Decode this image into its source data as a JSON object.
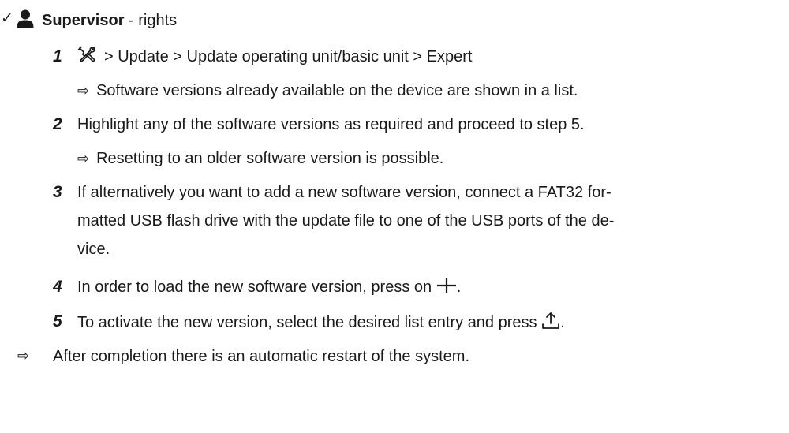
{
  "requirement": {
    "check": "✓",
    "role": "Supervisor",
    "suffix": " - rights"
  },
  "result_arrow": "⇨",
  "steps": [
    {
      "number": "1",
      "path": "> Update > Update operating unit/basic unit > Expert",
      "result": "Software versions already available on the device are shown in a list."
    },
    {
      "number": "2",
      "text": "Highlight any of the software versions as required and proceed to step 5.",
      "result": "Resetting to an older software version is possible."
    },
    {
      "number": "3",
      "lines": [
        "If alternatively you want to add a new software version, connect a FAT32 for-",
        "matted USB flash drive with the update file to one of the USB ports of the de-",
        "vice."
      ]
    },
    {
      "number": "4",
      "text_before": "In order to load the new software version, press on ",
      "text_after": "."
    },
    {
      "number": "5",
      "text_before": "To activate the new version, select the desired list entry and press ",
      "text_after": "."
    }
  ],
  "final_result": "After completion there is an automatic restart of the system.",
  "icons": [
    "check-icon",
    "person-icon",
    "tools-icon",
    "plus-icon",
    "upload-icon"
  ]
}
